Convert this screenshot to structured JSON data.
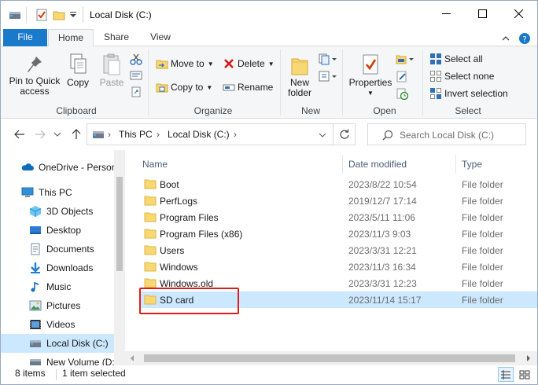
{
  "window": {
    "title": "Local Disk (C:)",
    "minimize_label": "Minimize",
    "maximize_label": "Maximize",
    "close_label": "Close"
  },
  "tabs": [
    {
      "label": "File"
    },
    {
      "label": "Home"
    },
    {
      "label": "Share"
    },
    {
      "label": "View"
    }
  ],
  "ribbon": {
    "clipboard": {
      "label": "Clipboard",
      "pin_label": "Pin to Quick access",
      "pin_line1": "Pin to Quick",
      "pin_line2": "access",
      "copy_label": "Copy",
      "paste_label": "Paste"
    },
    "organize": {
      "label": "Organize",
      "move_to": "Move to",
      "copy_to": "Copy to",
      "delete": "Delete",
      "rename": "Rename"
    },
    "new": {
      "label": "New",
      "new_folder_line1": "New",
      "new_folder_line2": "folder"
    },
    "open": {
      "label": "Open",
      "properties": "Properties"
    },
    "select": {
      "label": "Select",
      "select_all": "Select all",
      "select_none": "Select none",
      "invert_selection": "Invert selection"
    }
  },
  "address": {
    "segments": [
      "This PC",
      "Local Disk (C:)"
    ],
    "search_placeholder": "Search Local Disk (C:)"
  },
  "nav_pane": {
    "items": [
      {
        "label": "OneDrive - Person",
        "icon": "cloud-icon"
      },
      {
        "label": "This PC",
        "icon": "computer-icon"
      },
      {
        "label": "3D Objects",
        "icon": "cube-icon"
      },
      {
        "label": "Desktop",
        "icon": "desktop-icon"
      },
      {
        "label": "Documents",
        "icon": "document-icon"
      },
      {
        "label": "Downloads",
        "icon": "download-icon"
      },
      {
        "label": "Music",
        "icon": "music-icon"
      },
      {
        "label": "Pictures",
        "icon": "picture-icon"
      },
      {
        "label": "Videos",
        "icon": "video-icon"
      },
      {
        "label": "Local Disk (C:)",
        "icon": "drive-icon",
        "selected": true
      },
      {
        "label": "New Volume (D:",
        "icon": "drive-icon"
      }
    ]
  },
  "file_list": {
    "columns": [
      "Name",
      "Date modified",
      "Type"
    ],
    "rows": [
      {
        "name": "Boot",
        "date": "2023/8/22 10:54",
        "type": "File folder"
      },
      {
        "name": "PerfLogs",
        "date": "2019/12/7 17:14",
        "type": "File folder"
      },
      {
        "name": "Program Files",
        "date": "2023/5/11 11:06",
        "type": "File folder"
      },
      {
        "name": "Program Files (x86)",
        "date": "2023/11/3 9:03",
        "type": "File folder"
      },
      {
        "name": "Users",
        "date": "2023/3/31 12:21",
        "type": "File folder"
      },
      {
        "name": "Windows",
        "date": "2023/11/3 16:34",
        "type": "File folder"
      },
      {
        "name": "Windows.old",
        "date": "2023/3/31 12:23",
        "type": "File folder"
      },
      {
        "name": "SD card",
        "date": "2023/11/14 15:17",
        "type": "File folder",
        "selected": true
      }
    ]
  },
  "status": {
    "item_count": "8 items",
    "selection": "1 item selected"
  },
  "colors": {
    "accent": "#1979ca",
    "selection": "#cce8ff",
    "highlight_box": "#e21b1b",
    "folder": "#f8d775"
  }
}
